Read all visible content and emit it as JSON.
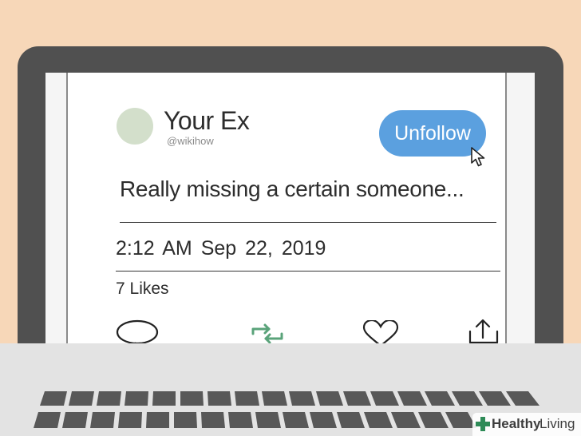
{
  "profile": {
    "name": "Your Ex",
    "handle": "@wikihow",
    "avatar_color": "#d3dfcb"
  },
  "unfollow_button": {
    "label": "Unfollow",
    "color": "#5ba0df"
  },
  "tweet": {
    "text": "Really missing a certain someone...",
    "time": "2:12 AM",
    "date": "Sep 22, 2019",
    "likes": "7 Likes"
  },
  "actions": [
    {
      "icon": "reply-bubble-icon"
    },
    {
      "icon": "retweet-icon",
      "color": "#5aa37a"
    },
    {
      "icon": "heart-icon"
    },
    {
      "icon": "share-icon"
    }
  ],
  "watermark": {
    "brand_bold": "Healthy",
    "brand_light": "Living",
    "accent": "#2e8b57"
  }
}
